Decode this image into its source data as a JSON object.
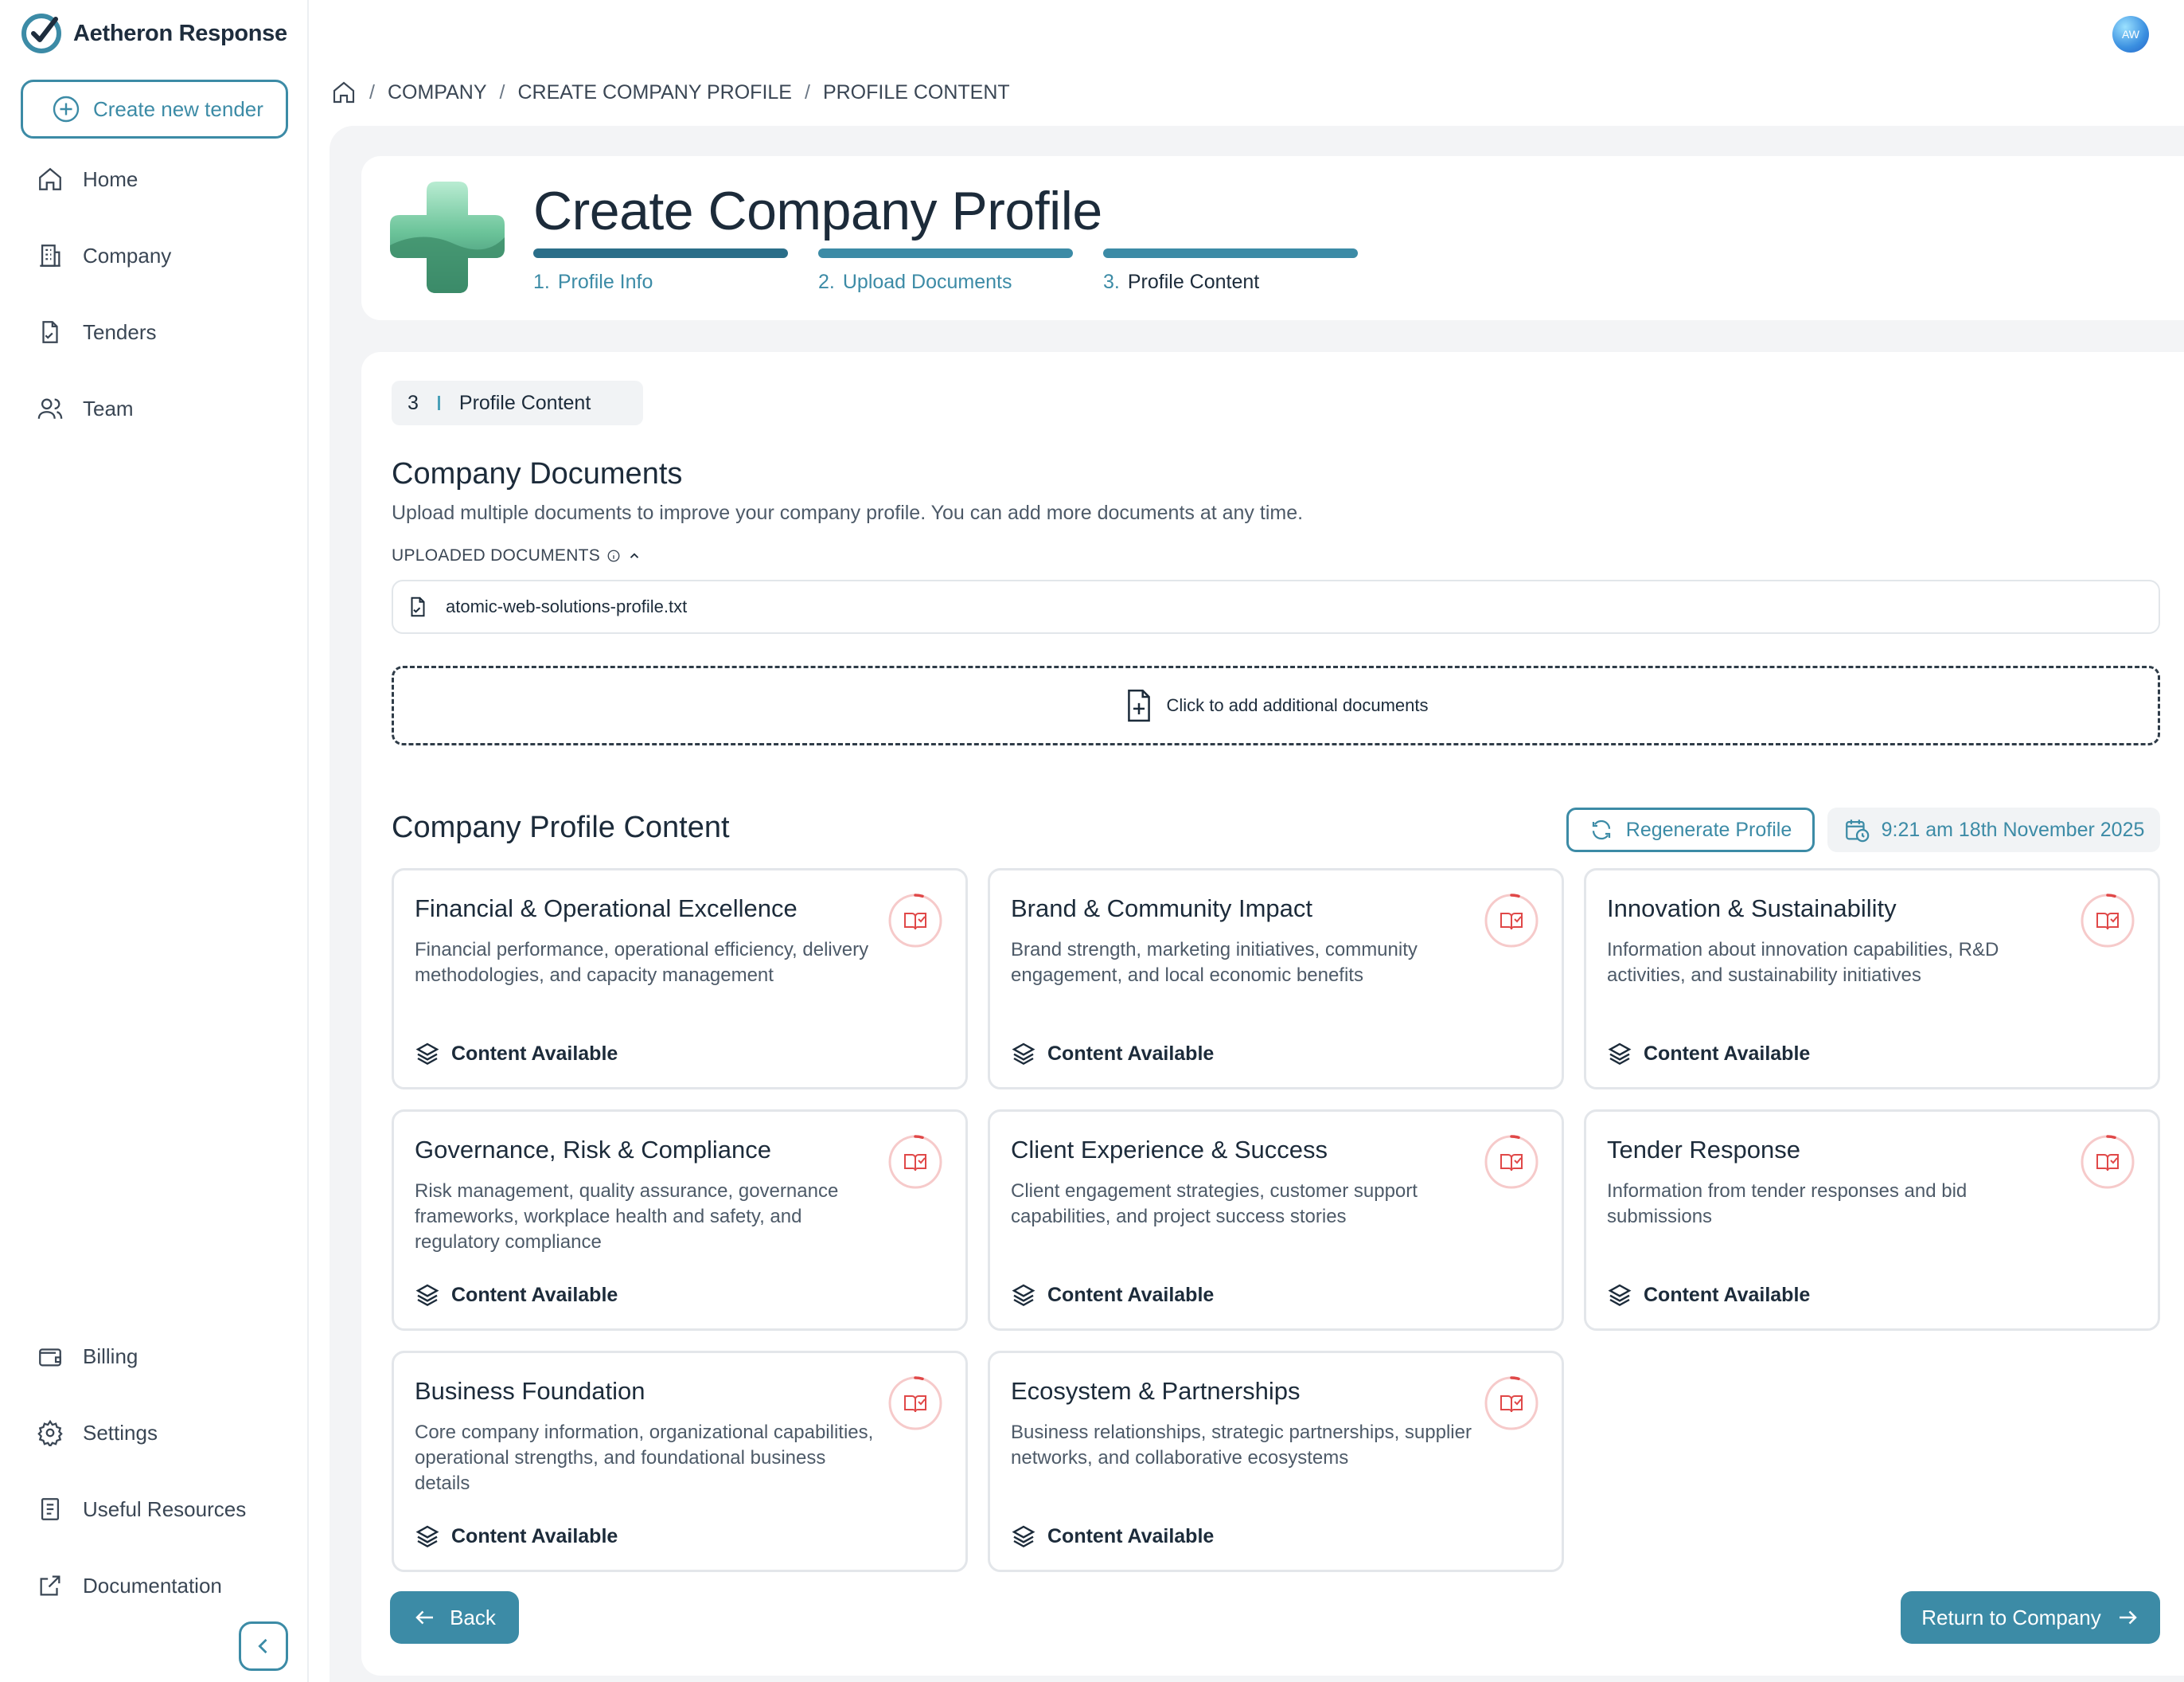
{
  "app": {
    "name": "Aetheron Response",
    "user_initials": "AW",
    "accent_color": "#3c8ba6"
  },
  "sidebar": {
    "create_label": "Create new tender",
    "items": [
      {
        "label": "Home",
        "icon": "home-icon"
      },
      {
        "label": "Company",
        "icon": "building-icon"
      },
      {
        "label": "Tenders",
        "icon": "file-sign-icon"
      },
      {
        "label": "Team",
        "icon": "users-icon"
      }
    ],
    "bottom_items": [
      {
        "label": "Billing",
        "icon": "wallet-icon"
      },
      {
        "label": "Settings",
        "icon": "gear-icon"
      },
      {
        "label": "Useful Resources",
        "icon": "notebook-icon"
      },
      {
        "label": "Documentation",
        "icon": "external-link-icon"
      }
    ]
  },
  "breadcrumb": [
    "COMPANY",
    "CREATE COMPANY PROFILE",
    "PROFILE CONTENT"
  ],
  "header": {
    "title": "Create Company Profile",
    "steps": [
      {
        "num": "1.",
        "label": "Profile Info"
      },
      {
        "num": "2.",
        "label": "Upload Documents"
      },
      {
        "num": "3.",
        "label": "Profile Content"
      }
    ]
  },
  "step_chip": {
    "num": "3",
    "label": "Profile Content"
  },
  "documents": {
    "title": "Company Documents",
    "subtitle": "Upload multiple documents to improve your company profile. You can add more documents at any time.",
    "uploaded_label": "UPLOADED DOCUMENTS",
    "files": [
      "atomic-web-solutions-profile.txt"
    ],
    "dropzone_label": "Click to add additional documents"
  },
  "profile_content": {
    "title": "Company Profile Content",
    "regenerate_label": "Regenerate Profile",
    "timestamp": "9:21 am 18th November 2025",
    "tiles": [
      {
        "title": "Financial & Operational Excellence",
        "desc": "Financial performance, operational efficiency, delivery methodologies, and capacity management",
        "status": "Content Available"
      },
      {
        "title": "Brand & Community Impact",
        "desc": "Brand strength, marketing initiatives, community engagement, and local economic benefits",
        "status": "Content Available"
      },
      {
        "title": "Innovation & Sustainability",
        "desc": "Information about innovation capabilities, R&D activities, and sustainability initiatives",
        "status": "Content Available"
      },
      {
        "title": "Governance, Risk & Compliance",
        "desc": "Risk management, quality assurance, governance frameworks, workplace health and safety, and regulatory compliance",
        "status": "Content Available"
      },
      {
        "title": "Client Experience & Success",
        "desc": "Client engagement strategies, customer support capabilities, and project success stories",
        "status": "Content Available"
      },
      {
        "title": "Tender Response",
        "desc": "Information from tender responses and bid submissions",
        "status": "Content Available"
      },
      {
        "title": "Business Foundation",
        "desc": "Core company information, organizational capabilities, operational strengths, and foundational business details",
        "status": "Content Available"
      },
      {
        "title": "Ecosystem & Partnerships",
        "desc": "Business relationships, strategic partnerships, supplier networks, and collaborative ecosystems",
        "status": "Content Available"
      }
    ]
  },
  "footer": {
    "back_label": "Back",
    "return_label": "Return to Company"
  }
}
